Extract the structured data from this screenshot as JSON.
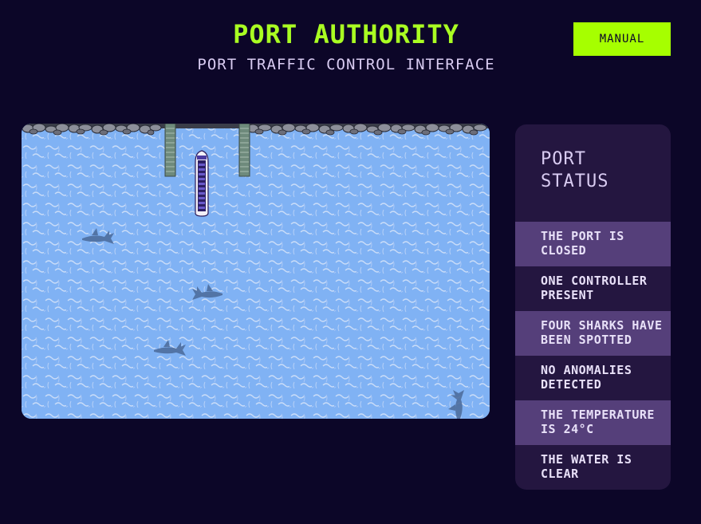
{
  "header": {
    "title": "PORT AUTHORITY",
    "subtitle": "PORT TRAFFIC CONTROL INTERFACE",
    "mode_button": "MANUAL"
  },
  "colors": {
    "background": "#0c0628",
    "accent": "#a6ff00",
    "water": "#7fb0f2",
    "panel": "#241640",
    "panel_highlight": "#553f7a"
  },
  "harbor": {
    "icons": [
      "rocky-shoreline",
      "pier",
      "cargo-ship",
      "shark"
    ],
    "ship_count": 1,
    "shark_count": 4,
    "pier_count": 2
  },
  "status": {
    "heading": "PORT STATUS",
    "items": [
      "THE PORT IS CLOSED",
      "ONE CONTROLLER PRESENT",
      "FOUR SHARKS HAVE BEEN SPOTTED",
      "NO ANOMALIES DETECTED",
      "THE TEMPERATURE IS 24°C",
      "THE WATER IS CLEAR"
    ]
  }
}
